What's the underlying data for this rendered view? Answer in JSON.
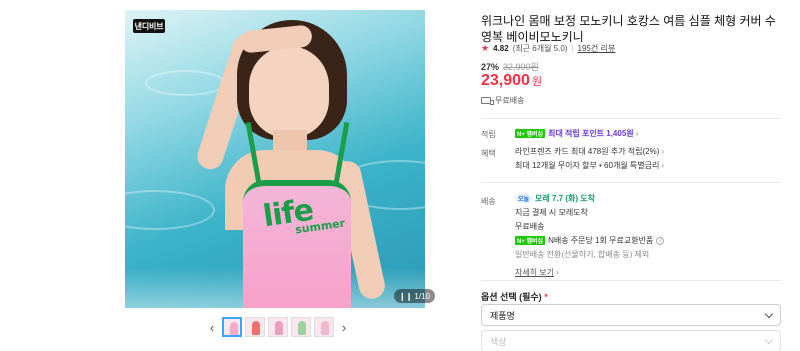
{
  "image": {
    "brand_badge": "낸디비브",
    "page_counter_icon": "pause-icon",
    "page_counter": "1/10",
    "suit_text": "life",
    "suit_subtext": "summer"
  },
  "thumbnails": {
    "prev_icon": "‹",
    "next_icon": "›",
    "items": [
      {
        "name": "thumb-1",
        "color": "#f3a9cc"
      },
      {
        "name": "thumb-2",
        "color": "#f07070"
      },
      {
        "name": "thumb-3",
        "color": "#e8a0c0"
      },
      {
        "name": "thumb-4",
        "color": "#9bd3a0"
      },
      {
        "name": "thumb-5",
        "color": "#f3b7d2"
      }
    ]
  },
  "product": {
    "title": "위크나인 몸매 보정 모노키니 호캉스 여름 심플 체형 커버 수영복 베이비모노키니",
    "rating_icon": "★",
    "rating": "4.82",
    "rating_note": "(최근 6개월 5.0)",
    "separator": "|",
    "reviews": "195건 리뷰",
    "discount_rate": "27%",
    "original_price": "32,900원",
    "price": "23,900",
    "price_unit": "원",
    "shipping_badge": "무료배송"
  },
  "points": {
    "label": "적립",
    "npay_badge": "N+ 멤버십",
    "text": "최대 적립 포인트 1,405원",
    "chevron": "›"
  },
  "benefits": {
    "label": "혜택",
    "line1": "라인프렌즈 카드 최대 478원 추가 적립(2%)",
    "line2": "최대 12개월 무이자 할부 • 60개월 특별금리"
  },
  "delivery": {
    "label": "배송",
    "today_badge": "오늘",
    "date": "모레 7.7 (화) 도착",
    "line1": "지금 결제 시 모레도착",
    "line2": "무료배송",
    "npay_badge": "N+ 멤버십",
    "line3": "N배송 주문당 1회 무료교환반품",
    "line4": "일반배송 전환(선물하기, 합배송 등) 제외",
    "more": "자세히 보기"
  },
  "options": {
    "label": "옵션 선택 (필수)",
    "required_mark": "*",
    "select1": "제품명",
    "select2": "색상"
  },
  "colors": {
    "accent_red": "#f43142",
    "npay_green": "#1ec800",
    "point_purple": "#6b3ad9",
    "arrival_green": "#1a9e6a"
  }
}
